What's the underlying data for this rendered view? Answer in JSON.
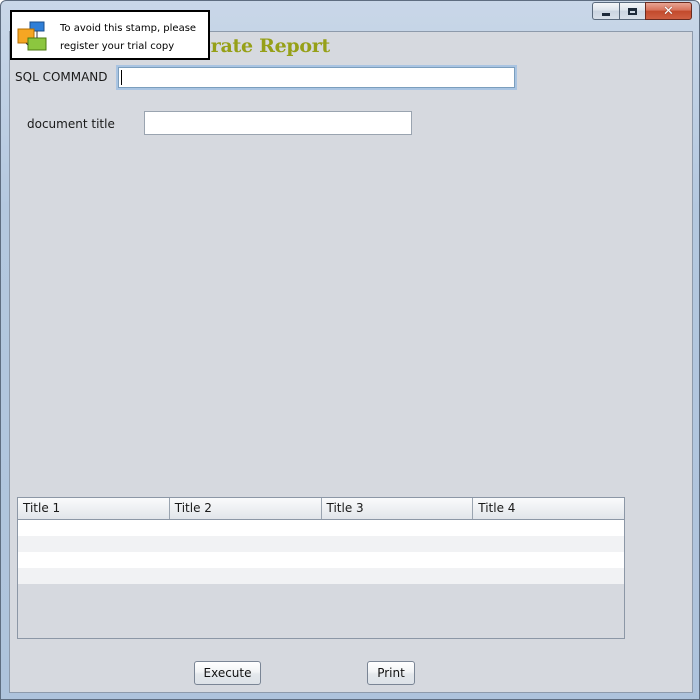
{
  "window": {
    "title": "",
    "controls": {
      "minimize_icon": "minimize-icon",
      "maximize_icon": "maximize-icon",
      "close_icon": "close-icon"
    }
  },
  "stamp": {
    "line1": "To avoid this stamp, please",
    "line2": "register your trial copy",
    "icon": "app-stamp-icon"
  },
  "report": {
    "title_visible": "erate Report",
    "title_color": "#96a018"
  },
  "form": {
    "sql_label": "SQL COMMAND",
    "sql_value": "",
    "doc_label": "document title",
    "doc_value": ""
  },
  "table": {
    "columns": [
      "Title 1",
      "Title 2",
      "Title 3",
      "Title 4"
    ],
    "rows": [
      [
        "",
        "",
        "",
        ""
      ],
      [
        "",
        "",
        "",
        ""
      ],
      [
        "",
        "",
        "",
        ""
      ],
      [
        "",
        "",
        "",
        ""
      ]
    ]
  },
  "buttons": {
    "execute": "Execute",
    "print": "Print"
  }
}
